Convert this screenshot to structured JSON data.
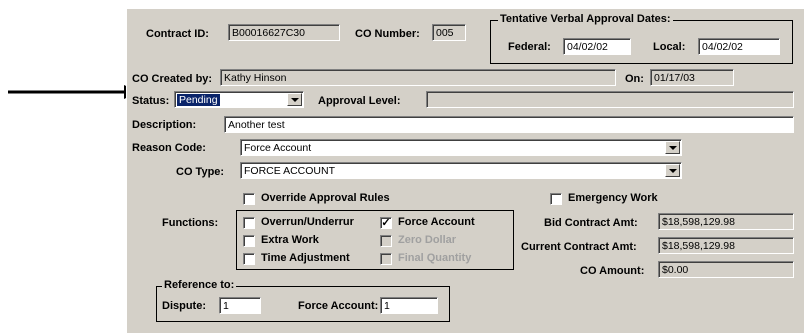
{
  "contract": {
    "id_label": "Contract ID:",
    "id_value": "B00016627C30",
    "co_number_label": "CO Number:",
    "co_number_value": "005"
  },
  "tentative": {
    "title": "Tentative Verbal Approval Dates:",
    "federal_label": "Federal:",
    "federal_value": "04/02/02",
    "local_label": "Local:",
    "local_value": "04/02/02"
  },
  "created": {
    "label": "CO Created by:",
    "value": "Kathy Hinson",
    "on_label": "On:",
    "on_value": "01/17/03"
  },
  "status": {
    "label": "Status:",
    "value": "Pending",
    "approval_label": "Approval Level:",
    "approval_value": ""
  },
  "description": {
    "label": "Description:",
    "value": "Another test"
  },
  "reason": {
    "label": "Reason Code:",
    "value": "Force Account"
  },
  "co_type": {
    "label": "CO Type:",
    "value": "FORCE ACCOUNT"
  },
  "options": {
    "override_label": "Override Approval Rules",
    "override_checked": false,
    "emergency_label": "Emergency Work",
    "emergency_checked": false
  },
  "functions": {
    "label": "Functions:",
    "items": [
      {
        "label": "Overrun/Underrur",
        "checked": false,
        "enabled": true
      },
      {
        "label": "Force Account",
        "checked": true,
        "enabled": true
      },
      {
        "label": "Extra Work",
        "checked": false,
        "enabled": true
      },
      {
        "label": "Zero Dollar",
        "checked": false,
        "enabled": false
      },
      {
        "label": "Time Adjustment",
        "checked": false,
        "enabled": true
      },
      {
        "label": "Final Quantity",
        "checked": false,
        "enabled": false
      }
    ]
  },
  "amounts": {
    "bid_label": "Bid Contract Amt:",
    "bid_value": "$18,598,129.98",
    "current_label": "Current Contract Amt:",
    "current_value": "$18,598,129.98",
    "co_label": "CO Amount:",
    "co_value": "$0.00"
  },
  "reference": {
    "title": "Reference to:",
    "dispute_label": "Dispute:",
    "dispute_value": "1",
    "force_label": "Force Account:",
    "force_value": "1"
  },
  "colors": {
    "panel": "#d4d0c8",
    "selection": "#0a246a"
  },
  "icons": {
    "pointer": "arrow-right-icon",
    "dropdown": "chevron-down-icon",
    "check": "checkmark-icon"
  }
}
